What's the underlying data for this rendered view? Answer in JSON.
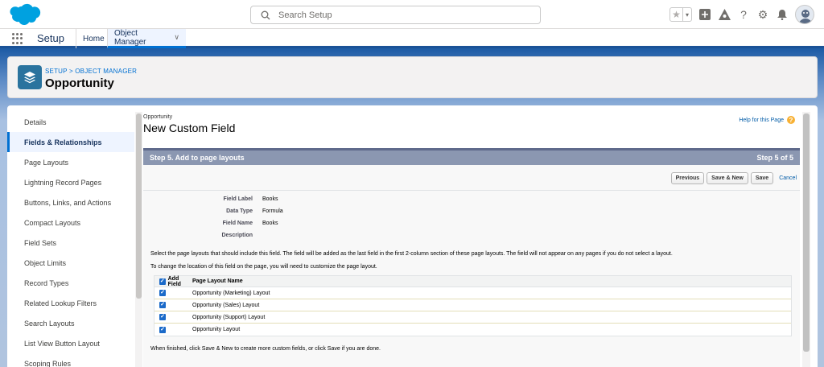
{
  "header": {
    "search_placeholder": "Search Setup",
    "icons": [
      "star-icon",
      "chevron-down-icon",
      "add-icon",
      "trailhead-icon",
      "help-icon",
      "gear-icon",
      "bell-icon",
      "avatar"
    ]
  },
  "navbar": {
    "app_name": "Setup",
    "tabs": [
      {
        "label": "Home"
      },
      {
        "label": "Object Manager"
      }
    ]
  },
  "object_header": {
    "breadcrumb": "SETUP > OBJECT MANAGER",
    "title": "Opportunity"
  },
  "sidebar": {
    "items": [
      {
        "label": "Details"
      },
      {
        "label": "Fields & Relationships"
      },
      {
        "label": "Page Layouts"
      },
      {
        "label": "Lightning Record Pages"
      },
      {
        "label": "Buttons, Links, and Actions"
      },
      {
        "label": "Compact Layouts"
      },
      {
        "label": "Field Sets"
      },
      {
        "label": "Object Limits"
      },
      {
        "label": "Record Types"
      },
      {
        "label": "Related Lookup Filters"
      },
      {
        "label": "Search Layouts"
      },
      {
        "label": "List View Button Layout"
      },
      {
        "label": "Scoping Rules"
      }
    ]
  },
  "content": {
    "object_name": "Opportunity",
    "page_title": "New Custom Field",
    "help_link": "Help for this Page",
    "step_title": "Step 5. Add to page layouts",
    "step_count": "Step 5 of 5",
    "buttons": {
      "previous": "Previous",
      "save_new": "Save & New",
      "save": "Save",
      "cancel": "Cancel"
    },
    "details": [
      {
        "label": "Field Label",
        "value": "Books"
      },
      {
        "label": "Data Type",
        "value": "Formula"
      },
      {
        "label": "Field Name",
        "value": "Books"
      },
      {
        "label": "Description",
        "value": ""
      }
    ],
    "instruction_1": "Select the page layouts that should include this field. The field will be added as the last field in the first 2-column section of these page layouts. The field will not appear on any pages if you do not select a layout.",
    "instruction_2": "To change the location of this field on the page, you will need to customize the page layout.",
    "table": {
      "col_add": "Add Field",
      "col_name": "Page Layout Name",
      "rows": [
        {
          "name": "Opportunity (Marketing) Layout",
          "checked": true
        },
        {
          "name": "Opportunity (Sales) Layout",
          "checked": true
        },
        {
          "name": "Opportunity (Support) Layout",
          "checked": true
        },
        {
          "name": "Opportunity Layout",
          "checked": true
        }
      ]
    },
    "footer_text": "When finished, click Save & New to create more custom fields, or click Save if you are done."
  },
  "colors": {
    "brand_blue": "#0070d2",
    "banner_blue": "#1d5ba5",
    "step_header": "#8b97b1",
    "object_icon": "#2a739e"
  }
}
